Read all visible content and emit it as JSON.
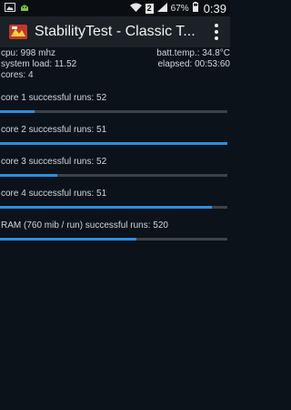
{
  "status_bar": {
    "sim_indicator": "2",
    "battery": "67%",
    "time": "0:39"
  },
  "action_bar": {
    "title": "StabilityTest - Classic T..."
  },
  "stats": {
    "cpu": "cpu: 998 mhz",
    "batt_temp": "batt.temp.: 34.8°C",
    "system_load": "system load: 11.52",
    "elapsed": "elapsed: 00:53:60",
    "cores": "cores: 4"
  },
  "runs": [
    {
      "label": "core 1 successful runs: 52",
      "progress": 0.15
    },
    {
      "label": "core 2 successful runs: 51",
      "progress": 1.0
    },
    {
      "label": "core 3 successful runs: 52",
      "progress": 0.25
    },
    {
      "label": "core 4 successful runs: 51",
      "progress": 0.93
    },
    {
      "label": "RAM (760 mib / run) successful runs: 520",
      "progress": 0.6
    }
  ],
  "colors": {
    "accent": "#2e8ee0",
    "track": "#3c4248",
    "background": "#0c1219"
  }
}
